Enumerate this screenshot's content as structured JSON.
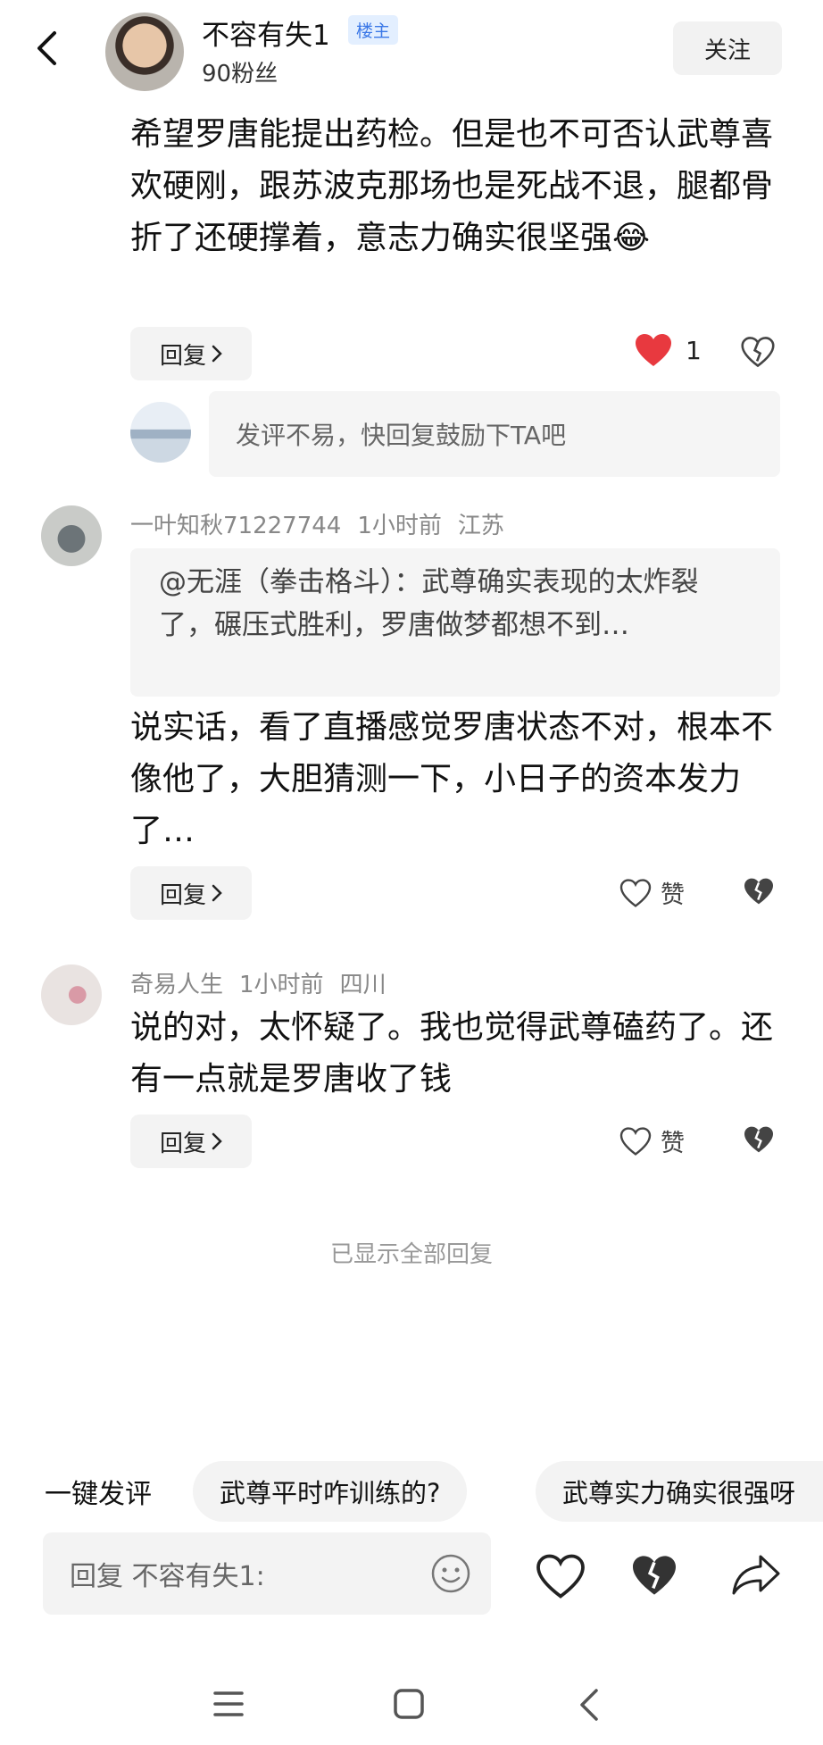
{
  "header": {
    "author_name": "不容有失1",
    "op_badge": "楼主",
    "fans": "90粉丝",
    "follow_label": "关注"
  },
  "main_comment": {
    "text": "希望罗唐能提出药检。但是也不可否认武尊喜欢硬刚，跟苏波克那场也是死战不退，腿都骨折了还硬撑着，意志力确实很坚强😂",
    "reply_label": "回复",
    "like_count": "1",
    "reply_prompt": "发评不易，快回复鼓励下TA吧"
  },
  "replies": [
    {
      "user": "一叶知秋71227744",
      "time": "1小时前",
      "location": "江苏",
      "quote": "@无涯（拳击格斗）：武尊确实表现的太炸裂了，碾压式胜利，罗唐做梦都想不到…",
      "text": "说实话，看了直播感觉罗唐状态不对，根本不像他了，大胆猜测一下，小日子的资本发力了…",
      "reply_label": "回复",
      "like_label": "赞"
    },
    {
      "user": "奇易人生",
      "time": "1小时前",
      "location": "四川",
      "text": "说的对，太怀疑了。我也觉得武尊磕药了。还有一点就是罗唐收了钱",
      "reply_label": "回复",
      "like_label": "赞"
    }
  ],
  "all_shown": "已显示全部回复",
  "quick_comment": {
    "label": "一键发评",
    "chips": [
      "武尊平时咋训练的?",
      "武尊实力确实很强呀"
    ]
  },
  "reply_input": {
    "placeholder": "回复 不容有失1:"
  },
  "colors": {
    "like_red": "#e8393f",
    "badge_blue": "#3b78e7"
  }
}
